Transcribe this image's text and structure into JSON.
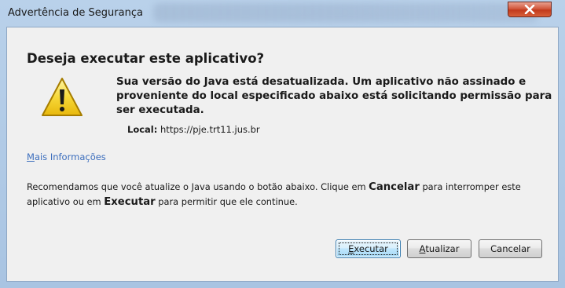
{
  "window": {
    "title": "Advertência de Segurança",
    "close_icon": "close-icon"
  },
  "dialog": {
    "question": "Deseja executar este aplicativo?",
    "warning_icon": "warning-icon",
    "message": "Sua versão do Java está desatualizada. Um aplicativo não assinado e proveniente do local especificado abaixo está solicitando permissão para ser executada.",
    "local_label": "Local:",
    "local_value": "https://pje.trt11.jus.br",
    "more_info_first": "M",
    "more_info_rest": "ais Informações",
    "recommend": {
      "part1": "Recomendamos que você atualize o Java usando o botão abaixo. Clique em ",
      "cancel_word": "Cancelar",
      "part2": " para interromper este aplicativo ou em ",
      "exec_word": "Executar",
      "part3": " para permitir que ele continue."
    }
  },
  "buttons": {
    "execute_first": "E",
    "execute_rest": "xecutar",
    "update_first": "A",
    "update_rest": "tualizar",
    "cancel": "Cancelar"
  },
  "colors": {
    "frame": "#b9d1ea",
    "client": "#f0f0f0",
    "link": "#3c6ebd",
    "close": "#c23a1c"
  }
}
